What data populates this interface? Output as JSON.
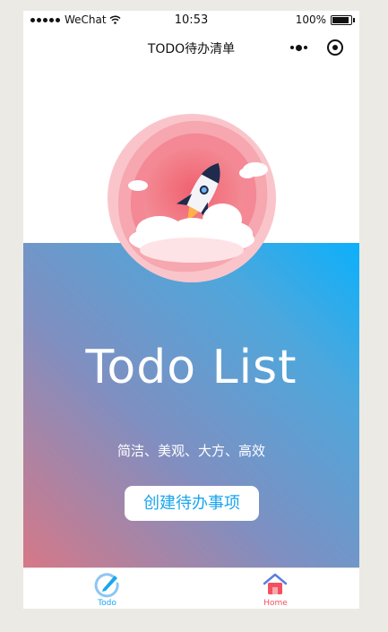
{
  "status_bar": {
    "carrier": "WeChat",
    "time": "10:53",
    "battery": "100%",
    "battery_level": 1.0
  },
  "nav": {
    "title": "TODO待办清单"
  },
  "hero": {
    "title": "Todo List",
    "subtitle": "简洁、美观、大方、高效",
    "cta_label": "创建待办事项"
  },
  "tab_bar": {
    "items": [
      {
        "label": "Todo",
        "icon": "edit-circle-icon",
        "color": "#1aa6ef"
      },
      {
        "label": "Home",
        "icon": "home-icon",
        "color": "#f2525f"
      }
    ]
  },
  "colors": {
    "gradient_start": "#0cb0fb",
    "gradient_end": "#d67887",
    "accent": "#1aa6ef"
  }
}
